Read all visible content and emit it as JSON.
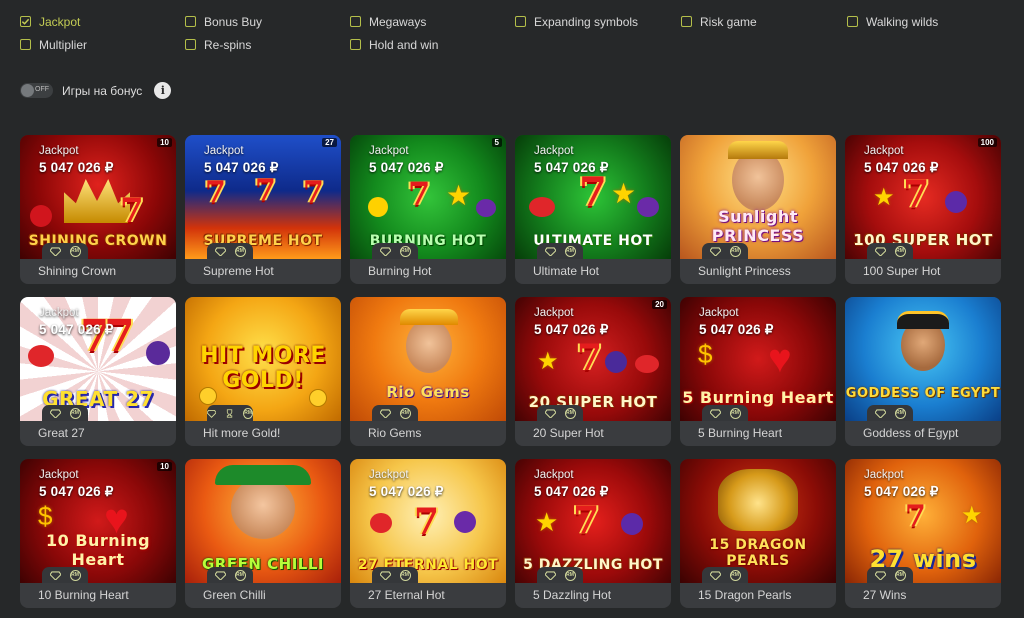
{
  "filters": [
    {
      "label": "Jackpot",
      "checked": true
    },
    {
      "label": "Bonus Buy",
      "checked": false
    },
    {
      "label": "Megaways",
      "checked": false
    },
    {
      "label": "Expanding symbols",
      "checked": false
    },
    {
      "label": "Risk game",
      "checked": false
    },
    {
      "label": "Walking wilds",
      "checked": false
    },
    {
      "label": "Multiplier",
      "checked": false
    },
    {
      "label": "Re-spins",
      "checked": false
    },
    {
      "label": "Hold and win",
      "checked": false
    }
  ],
  "bonus_toggle": {
    "state": "OFF",
    "label": "Игры на бонус",
    "info_icon": "i"
  },
  "jackpot": {
    "label": "Jackpot",
    "amount": "5 047 026 ₽"
  },
  "badges": {
    "first_icon": "diamond-icon",
    "second_icon": "rm-icon",
    "rm_text": "RM"
  },
  "accent_color": "#c3cc54",
  "games": [
    {
      "name": "Shining Crown",
      "logo": "SHINING CROWN",
      "corner": "10",
      "jackpot": true
    },
    {
      "name": "Supreme Hot",
      "logo": "SUPREME HOT",
      "corner": "27",
      "jackpot": true
    },
    {
      "name": "Burning Hot",
      "logo": "BURNING HOT",
      "corner": "5",
      "jackpot": true
    },
    {
      "name": "Ultimate Hot",
      "logo": "ULTIMATE HOT",
      "corner": "",
      "jackpot": true
    },
    {
      "name": "Sunlight Princess",
      "logo": "Sunlight PRINCESS",
      "corner": "",
      "jackpot": false
    },
    {
      "name": "100 Super Hot",
      "logo": "100 SUPER HOT",
      "corner": "100",
      "jackpot": true
    },
    {
      "name": "Great 27",
      "logo": "GREAT 27",
      "corner": "",
      "jackpot": true
    },
    {
      "name": "Hit more Gold!",
      "logo": "HIT MORE GOLD!",
      "corner": "",
      "jackpot": false
    },
    {
      "name": "Rio Gems",
      "logo": "Rio Gems",
      "corner": "",
      "jackpot": false
    },
    {
      "name": "20 Super Hot",
      "logo": "20 SUPER HOT",
      "corner": "20",
      "jackpot": true
    },
    {
      "name": "5 Burning Heart",
      "logo": "5 Burning Heart",
      "corner": "",
      "jackpot": true
    },
    {
      "name": "Goddess of Egypt",
      "logo": "GODDESS OF EGYPT",
      "corner": "",
      "jackpot": false
    },
    {
      "name": "10 Burning Heart",
      "logo": "10 Burning Heart",
      "corner": "10",
      "jackpot": true
    },
    {
      "name": "Green Chilli",
      "logo": "GREEN CHILLI",
      "corner": "",
      "jackpot": false
    },
    {
      "name": "27 Eternal Hot",
      "logo": "27 ETERNAL HOT",
      "corner": "",
      "jackpot": true
    },
    {
      "name": "5 Dazzling Hot",
      "logo": "5 DAZZLING HOT",
      "corner": "",
      "jackpot": true
    },
    {
      "name": "15 Dragon Pearls",
      "logo": "15 DRAGON PEARLS",
      "corner": "",
      "jackpot": false
    },
    {
      "name": "27 Wins",
      "logo": "27 wins",
      "corner": "",
      "jackpot": true
    }
  ]
}
